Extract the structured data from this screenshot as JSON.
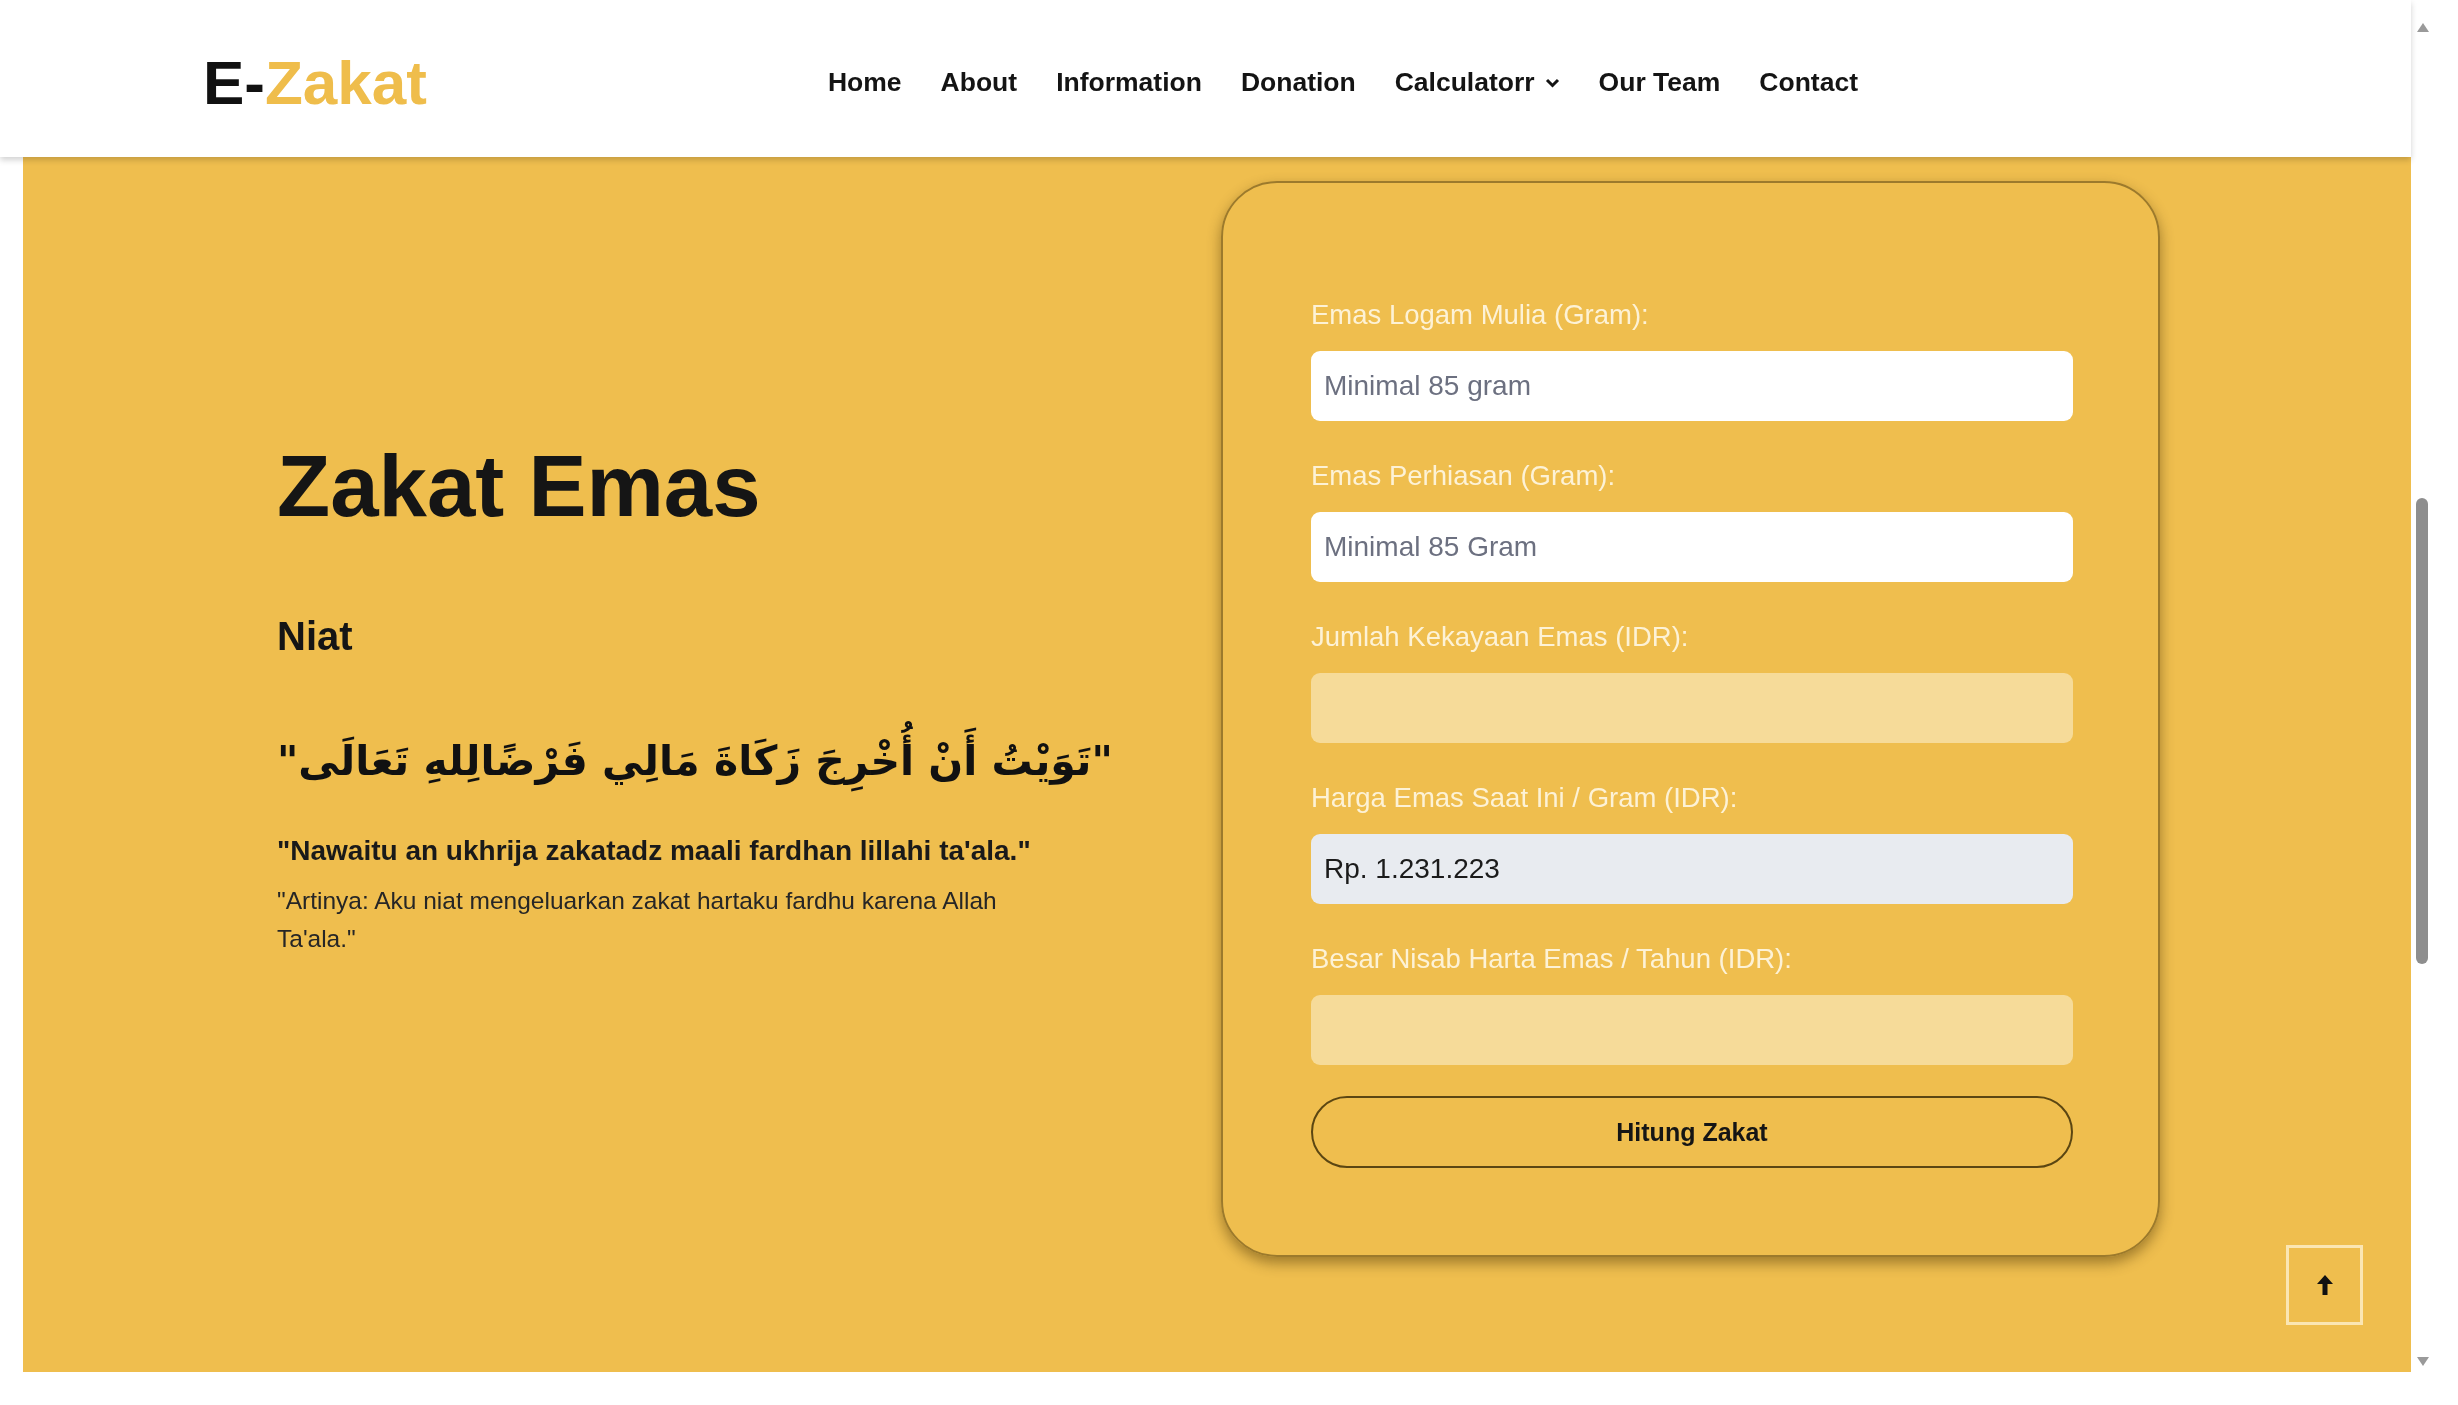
{
  "header": {
    "logo": [
      {
        "text": "E-",
        "kind": "plain"
      },
      {
        "text": "Zakat",
        "kind": "accent"
      }
    ],
    "nav": [
      {
        "label": "Home",
        "has_dropdown": false
      },
      {
        "label": "About",
        "has_dropdown": false
      },
      {
        "label": "Information",
        "has_dropdown": false
      },
      {
        "label": "Donation",
        "has_dropdown": false
      },
      {
        "label": "Calculatorr",
        "has_dropdown": true
      },
      {
        "label": "Our Team",
        "has_dropdown": false
      },
      {
        "label": "Contact",
        "has_dropdown": false
      }
    ]
  },
  "intro": {
    "title": "Zakat Emas",
    "subtitle": "Niat",
    "arabic": "\"تَوَيْتُ أَنْ أُخْرِجَ زَكَاةَ مَالِي فَرْضًالِلهِ تَعَالَى\"",
    "transliteration": "\"Nawaitu an ukhrija zakatadz maali fardhan lillahi ta'ala.\"",
    "translation": "\"Artinya: Aku niat mengeluarkan zakat hartaku fardhu karena Allah Ta'ala.\""
  },
  "calculator": {
    "fields": [
      {
        "label": "Emas Logam Mulia (Gram):",
        "kind": "entry",
        "placeholder": "Minimal 85 gram"
      },
      {
        "label": "Emas Perhiasan (Gram):",
        "kind": "entry",
        "placeholder": "Minimal 85 Gram"
      },
      {
        "label": "Jumlah Kekayaan Emas (IDR):",
        "kind": "result"
      },
      {
        "label": "Harga Emas Saat Ini / Gram (IDR):",
        "kind": "preset",
        "value": "Rp. 1.231.223"
      },
      {
        "label": "Besar Nisab Harta Emas / Tahun (IDR):",
        "kind": "result"
      }
    ],
    "button": "Hitung Zakat"
  }
}
